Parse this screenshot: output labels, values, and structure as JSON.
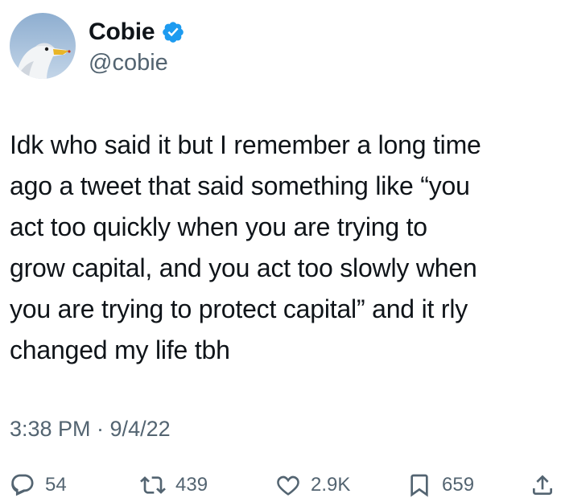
{
  "author": {
    "display_name": "Cobie",
    "handle": "@cobie",
    "verified": true
  },
  "tweet": {
    "text": "Idk who said it but I remember a long time\nago a tweet that said something like “you\nact too quickly when you are trying to\ngrow capital, and you act too slowly when\nyou are trying to protect capital” and it rly\nchanged my life tbh",
    "timestamp": "3:38 PM · 9/4/22"
  },
  "metrics": {
    "replies": "54",
    "retweets": "439",
    "likes": "2.9K",
    "bookmarks": "659"
  },
  "icons": {
    "verified": "verified-badge-icon",
    "reply": "reply-icon",
    "retweet": "retweet-icon",
    "like": "heart-icon",
    "bookmark": "bookmark-icon",
    "share": "share-icon"
  },
  "colors": {
    "text": "#0f1419",
    "secondary": "#536471",
    "verified": "#1d9bf0"
  }
}
